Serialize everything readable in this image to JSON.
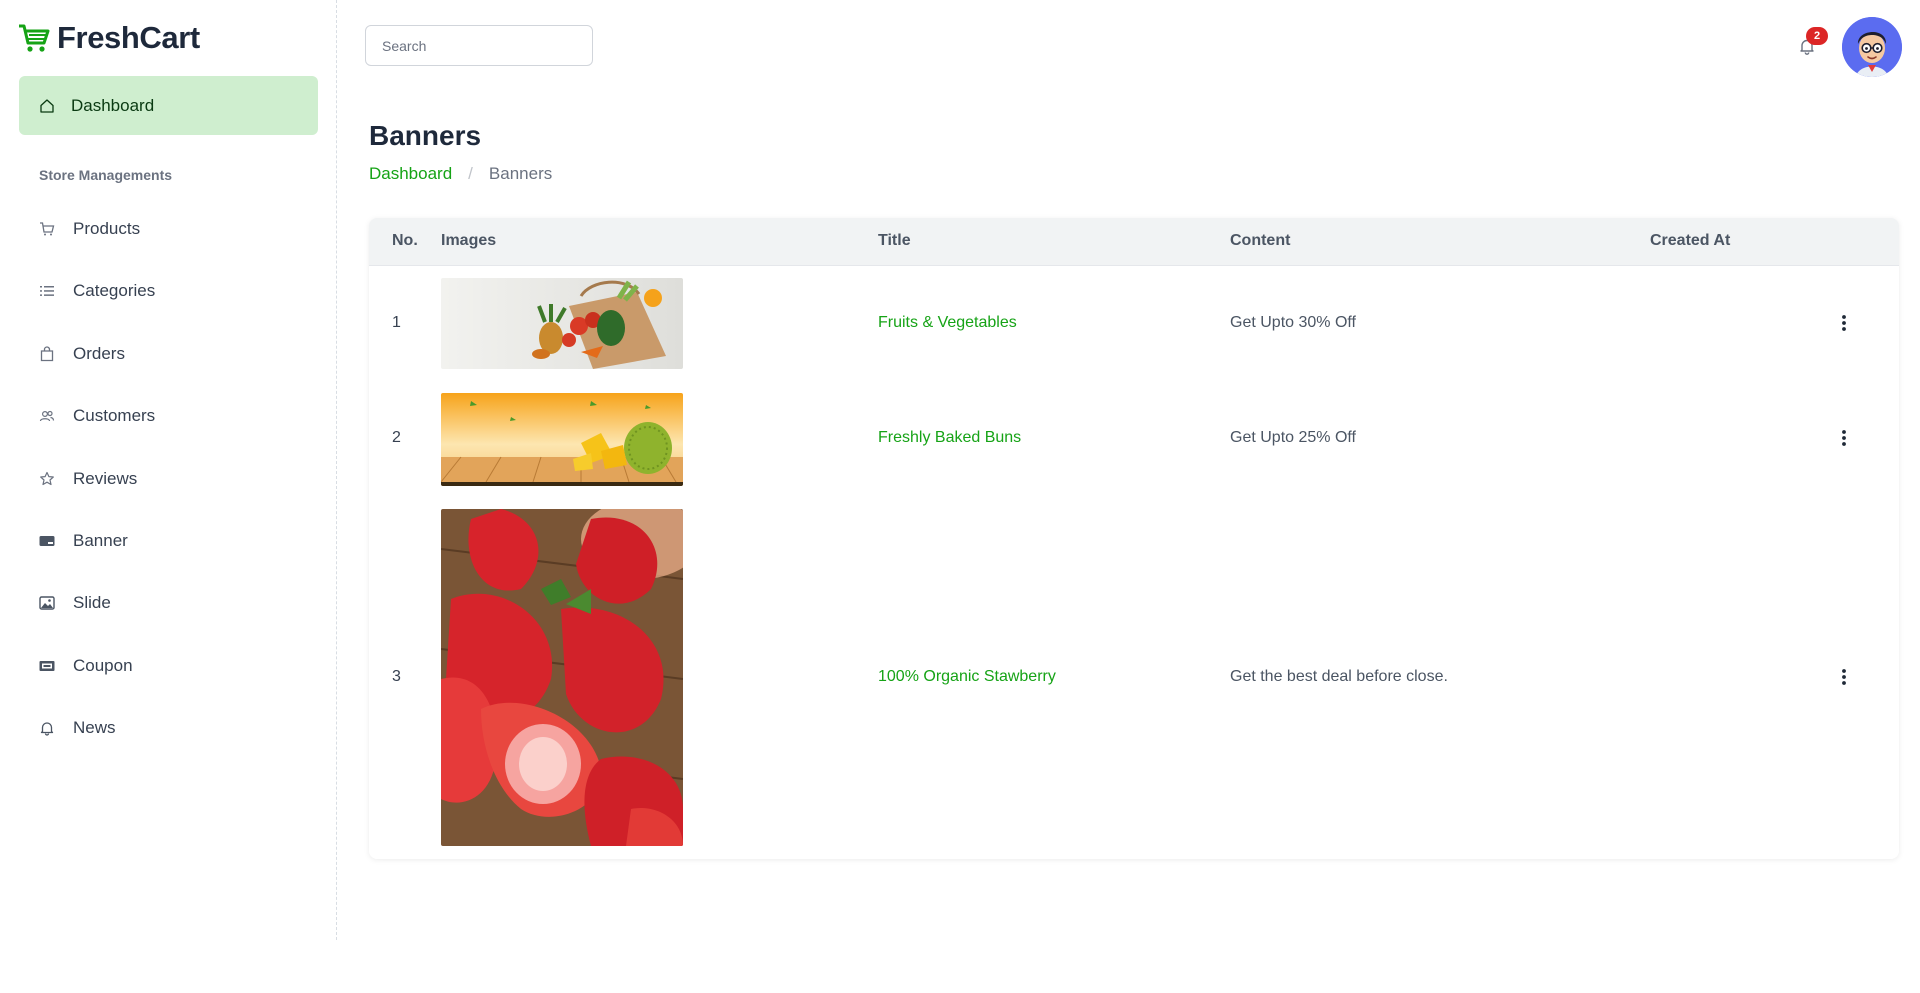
{
  "brand": {
    "name": "FreshCart",
    "accent": "#16a316"
  },
  "sidebar": {
    "active": {
      "label": "Dashboard",
      "icon": "home-icon"
    },
    "section_label": "Store Managements",
    "items": [
      {
        "label": "Products",
        "icon": "cart-icon"
      },
      {
        "label": "Categories",
        "icon": "list-icon"
      },
      {
        "label": "Orders",
        "icon": "bag-icon"
      },
      {
        "label": "Customers",
        "icon": "users-icon"
      },
      {
        "label": "Reviews",
        "icon": "star-icon"
      },
      {
        "label": "Banner",
        "icon": "banner-icon"
      },
      {
        "label": "Slide",
        "icon": "image-icon"
      },
      {
        "label": "Coupon",
        "icon": "ticket-icon"
      },
      {
        "label": "News",
        "icon": "bell-icon"
      }
    ]
  },
  "topbar": {
    "search_placeholder": "Search",
    "notification_count": "2"
  },
  "page": {
    "title": "Banners",
    "breadcrumb": {
      "home": "Dashboard",
      "current": "Banners"
    }
  },
  "table": {
    "headers": {
      "no": "No.",
      "images": "Images",
      "title": "Title",
      "content": "Content",
      "created": "Created At"
    },
    "rows": [
      {
        "no": "1",
        "title": "Fruits & Vegetables",
        "content": "Get Upto 30% Off",
        "created": "",
        "image": "grocery-bag-image"
      },
      {
        "no": "2",
        "title": "Freshly Baked Buns",
        "content": "Get Upto 25% Off",
        "created": "",
        "image": "durian-banner-image"
      },
      {
        "no": "3",
        "title": "100% Organic Stawberry",
        "content": "Get the best deal before close.",
        "created": "",
        "image": "strawberries-image"
      }
    ]
  }
}
